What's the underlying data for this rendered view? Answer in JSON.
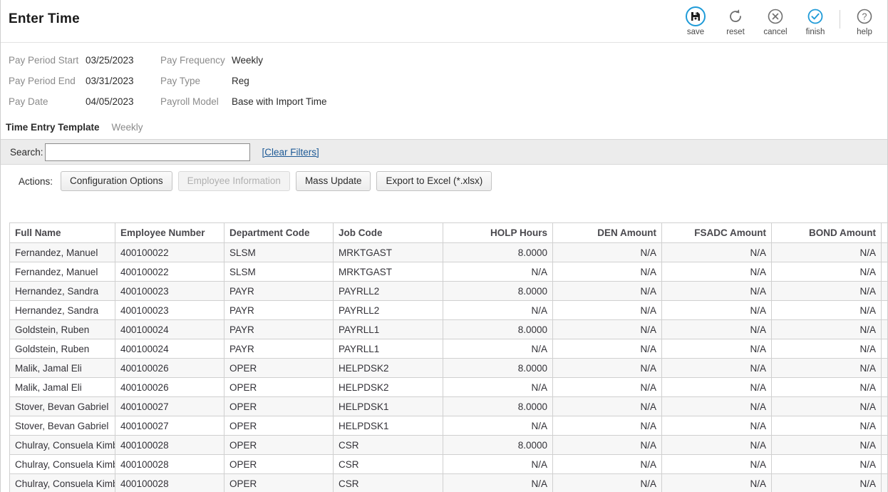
{
  "header": {
    "title": "Enter Time",
    "toolbar": [
      {
        "name": "save",
        "label": "save",
        "icon": "save-icon",
        "state": "active"
      },
      {
        "name": "reset",
        "label": "reset",
        "icon": "reset-icon",
        "state": "normal"
      },
      {
        "name": "cancel",
        "label": "cancel",
        "icon": "cancel-icon",
        "state": "normal"
      },
      {
        "name": "finish",
        "label": "finish",
        "icon": "finish-icon",
        "state": "accent"
      },
      {
        "name": "help",
        "label": "help",
        "icon": "help-icon",
        "state": "normal"
      }
    ]
  },
  "colors": {
    "accent": "#1f9bd8",
    "link": "#1e5a96",
    "band": "#ececec",
    "grid_line": "#d0d0d0",
    "alt_row": "#f7f7f7"
  },
  "meta": {
    "rows": [
      {
        "label1": "Pay Period Start",
        "value1": "03/25/2023",
        "label2": "Pay Frequency",
        "value2": "Weekly"
      },
      {
        "label1": "Pay Period End",
        "value1": "03/31/2023",
        "label2": "Pay Type",
        "value2": "Reg"
      },
      {
        "label1": "Pay Date",
        "value1": "04/05/2023",
        "label2": "Payroll Model",
        "value2": "Base with Import Time"
      }
    ]
  },
  "template": {
    "label": "Time Entry Template",
    "value": "Weekly"
  },
  "search": {
    "label": "Search:",
    "value": "",
    "placeholder": "",
    "clear_filters": "[Clear Filters]"
  },
  "actions": {
    "label": "Actions:",
    "buttons": [
      {
        "label": "Configuration Options",
        "disabled": false
      },
      {
        "label": "Employee Information",
        "disabled": true
      },
      {
        "label": "Mass Update",
        "disabled": false
      },
      {
        "label": "Export to Excel (*.xlsx)",
        "disabled": false
      }
    ]
  },
  "grid": {
    "columns": [
      {
        "label": "Full Name",
        "align": "left",
        "key": "c-name"
      },
      {
        "label": "Employee Number",
        "align": "left",
        "key": "c-emp"
      },
      {
        "label": "Department Code",
        "align": "left",
        "key": "c-dept"
      },
      {
        "label": "Job Code",
        "align": "left",
        "key": "c-job"
      },
      {
        "label": "HOLP Hours",
        "align": "right",
        "key": "c-holp"
      },
      {
        "label": "DEN Amount",
        "align": "right",
        "key": "c-den"
      },
      {
        "label": "FSADC Amount",
        "align": "right",
        "key": "c-fsadc"
      },
      {
        "label": "BOND Amount",
        "align": "right",
        "key": "c-bond"
      },
      {
        "label": "",
        "align": "right",
        "key": "c-extra"
      }
    ],
    "rows": [
      [
        "Fernandez, Manuel",
        "400100022",
        "SLSM",
        "MRKTGAST",
        "8.0000",
        "N/A",
        "N/A",
        "N/A",
        ""
      ],
      [
        "Fernandez, Manuel",
        "400100022",
        "SLSM",
        "MRKTGAST",
        "N/A",
        "N/A",
        "N/A",
        "N/A",
        ""
      ],
      [
        "Hernandez, Sandra",
        "400100023",
        "PAYR",
        "PAYRLL2",
        "8.0000",
        "N/A",
        "N/A",
        "N/A",
        ""
      ],
      [
        "Hernandez, Sandra",
        "400100023",
        "PAYR",
        "PAYRLL2",
        "N/A",
        "N/A",
        "N/A",
        "N/A",
        ""
      ],
      [
        "Goldstein, Ruben",
        "400100024",
        "PAYR",
        "PAYRLL1",
        "8.0000",
        "N/A",
        "N/A",
        "N/A",
        ""
      ],
      [
        "Goldstein, Ruben",
        "400100024",
        "PAYR",
        "PAYRLL1",
        "N/A",
        "N/A",
        "N/A",
        "N/A",
        ""
      ],
      [
        "Malik, Jamal Eli",
        "400100026",
        "OPER",
        "HELPDSK2",
        "8.0000",
        "N/A",
        "N/A",
        "N/A",
        ""
      ],
      [
        "Malik, Jamal Eli",
        "400100026",
        "OPER",
        "HELPDSK2",
        "N/A",
        "N/A",
        "N/A",
        "N/A",
        ""
      ],
      [
        "Stover, Bevan Gabriel",
        "400100027",
        "OPER",
        "HELPDSK1",
        "8.0000",
        "N/A",
        "N/A",
        "N/A",
        ""
      ],
      [
        "Stover, Bevan Gabriel",
        "400100027",
        "OPER",
        "HELPDSK1",
        "N/A",
        "N/A",
        "N/A",
        "N/A",
        ""
      ],
      [
        "Chulray, Consuela Kimberly",
        "400100028",
        "OPER",
        "CSR",
        "8.0000",
        "N/A",
        "N/A",
        "N/A",
        ""
      ],
      [
        "Chulray, Consuela Kimberly",
        "400100028",
        "OPER",
        "CSR",
        "N/A",
        "N/A",
        "N/A",
        "N/A",
        ""
      ],
      [
        "Chulray, Consuela Kimberly",
        "400100028",
        "OPER",
        "CSR",
        "N/A",
        "N/A",
        "N/A",
        "N/A",
        ""
      ]
    ]
  }
}
